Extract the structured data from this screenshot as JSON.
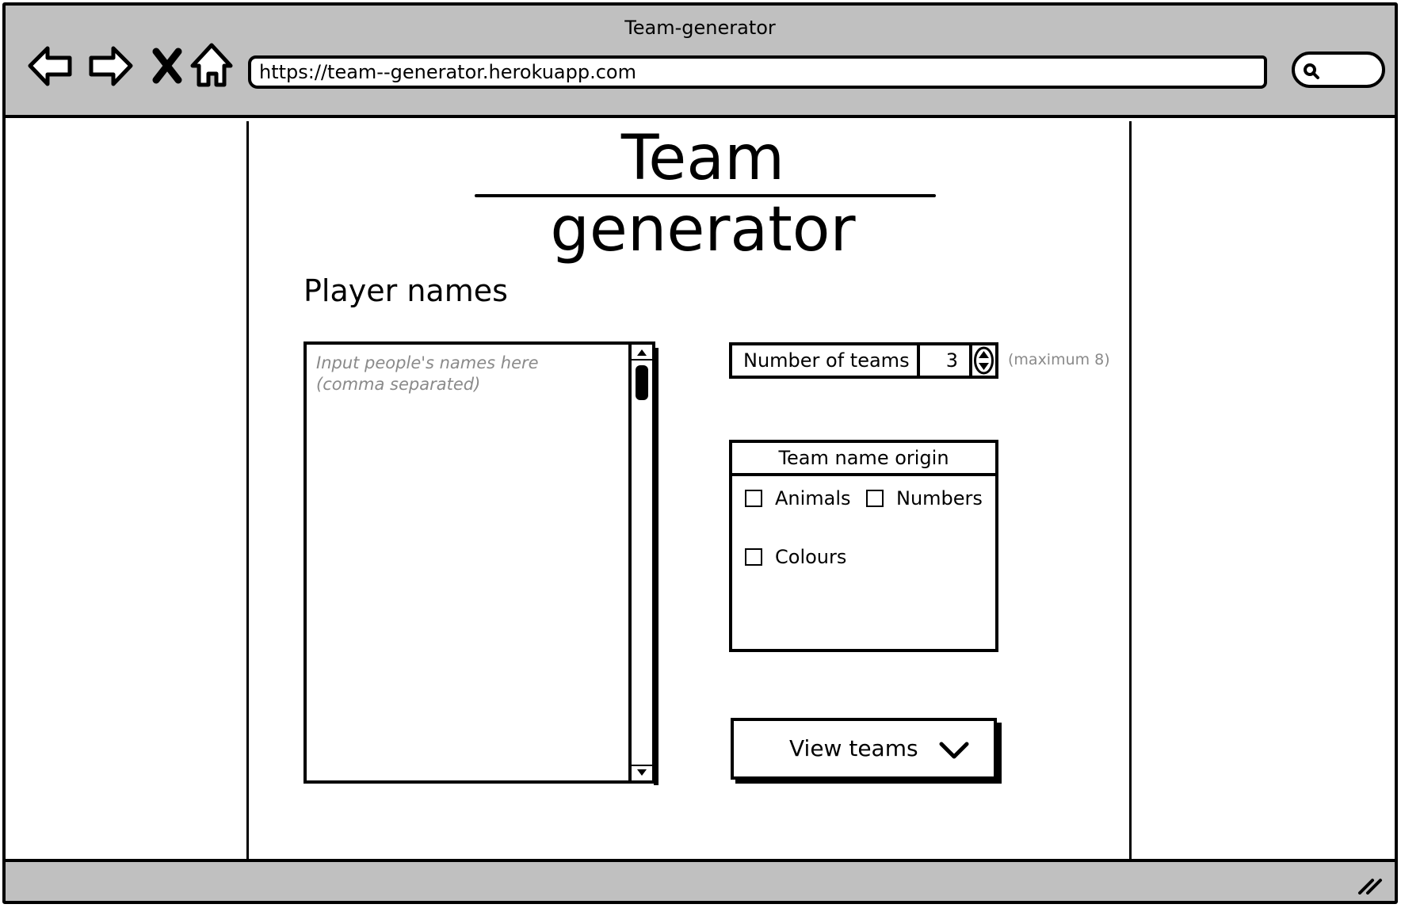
{
  "browser": {
    "window_title": "Team-generator",
    "url": "https://team--generator.herokuapp.com"
  },
  "page": {
    "title": "Team generator",
    "player_names": {
      "label": "Player names",
      "placeholder": "Input people's names here (comma separated)"
    },
    "number_of_teams": {
      "label": "Number of teams",
      "value": "3",
      "hint": "(maximum 8)"
    },
    "team_name_origin": {
      "header": "Team name origin",
      "options": [
        {
          "label": "Animals",
          "checked": false
        },
        {
          "label": "Numbers",
          "checked": false
        },
        {
          "label": "Colours",
          "checked": false
        }
      ]
    },
    "view_button": {
      "label": "View teams"
    }
  }
}
